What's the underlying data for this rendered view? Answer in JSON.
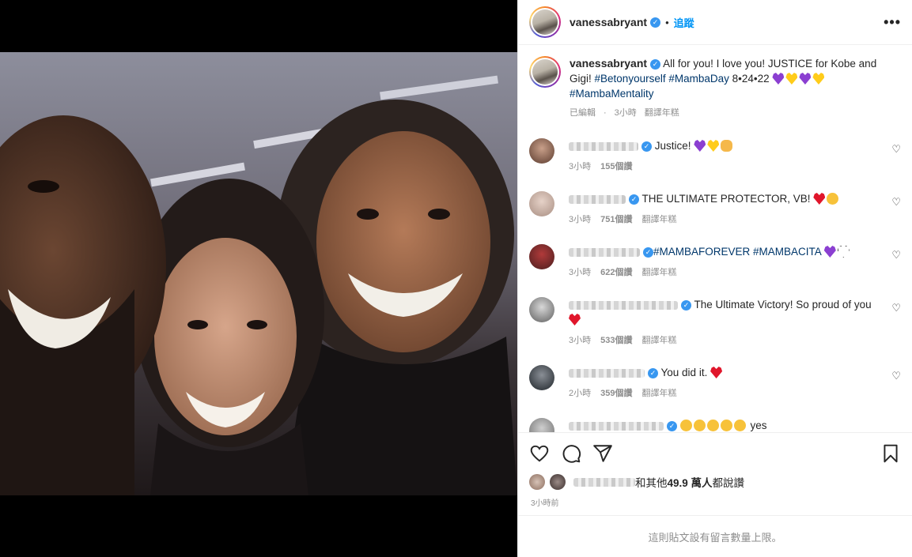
{
  "post": {
    "username": "vanessabryant",
    "follow_label": "追蹤",
    "more_label": "•••",
    "caption_text_1": "All for you! I love you! JUSTICE for Kobe and",
    "caption_text_2": "Gigi!",
    "caption_tag_1": "#Betonyourself",
    "caption_tag_2": "#MambaDay",
    "caption_date": "8•24•22",
    "caption_tag_3": "#MambaMentality",
    "edited_label": "已編輯",
    "caption_time": "3小時",
    "translate_label": "翻譯年糕"
  },
  "comments": [
    {
      "text": "Justice!",
      "time": "3小時",
      "likes": "155個讚",
      "translate": "",
      "emojis": [
        "purple-heart",
        "yellow-heart",
        "clap"
      ]
    },
    {
      "text": "THE ULTIMATE PROTECTOR, VB!",
      "time": "3小時",
      "likes": "751個讚",
      "translate": "翻譯年糕",
      "emojis": [
        "red-heart",
        "face"
      ]
    },
    {
      "text": "#MAMBAFOREVER #MAMBACITA",
      "time": "3小時",
      "likes": "622個讚",
      "translate": "翻譯年糕",
      "emojis": [
        "purple-heart",
        "white-heart"
      ]
    },
    {
      "text": "The Ultimate Victory! So proud of you",
      "time": "3小時",
      "likes": "533個讚",
      "translate": "翻譯年糕",
      "emojis": [
        "red-heart"
      ]
    },
    {
      "text": "You did it.",
      "time": "2小時",
      "likes": "359個讚",
      "translate": "翻譯年糕",
      "emojis": [
        "red-heart"
      ]
    },
    {
      "text": "yes",
      "time": "",
      "likes": "",
      "translate": "",
      "emojis": [
        "face",
        "face",
        "face",
        "face",
        "face"
      ]
    }
  ],
  "likes": {
    "prefix": "和其他",
    "count": "49.9 萬人",
    "suffix": "都說讚"
  },
  "post_time": "3小時前",
  "comments_closed": "這則貼文設有留言數量上限。",
  "colors": {
    "link": "#00376b",
    "follow": "#0095f6",
    "muted": "#8e8e8e",
    "verified": "#3897f0"
  }
}
